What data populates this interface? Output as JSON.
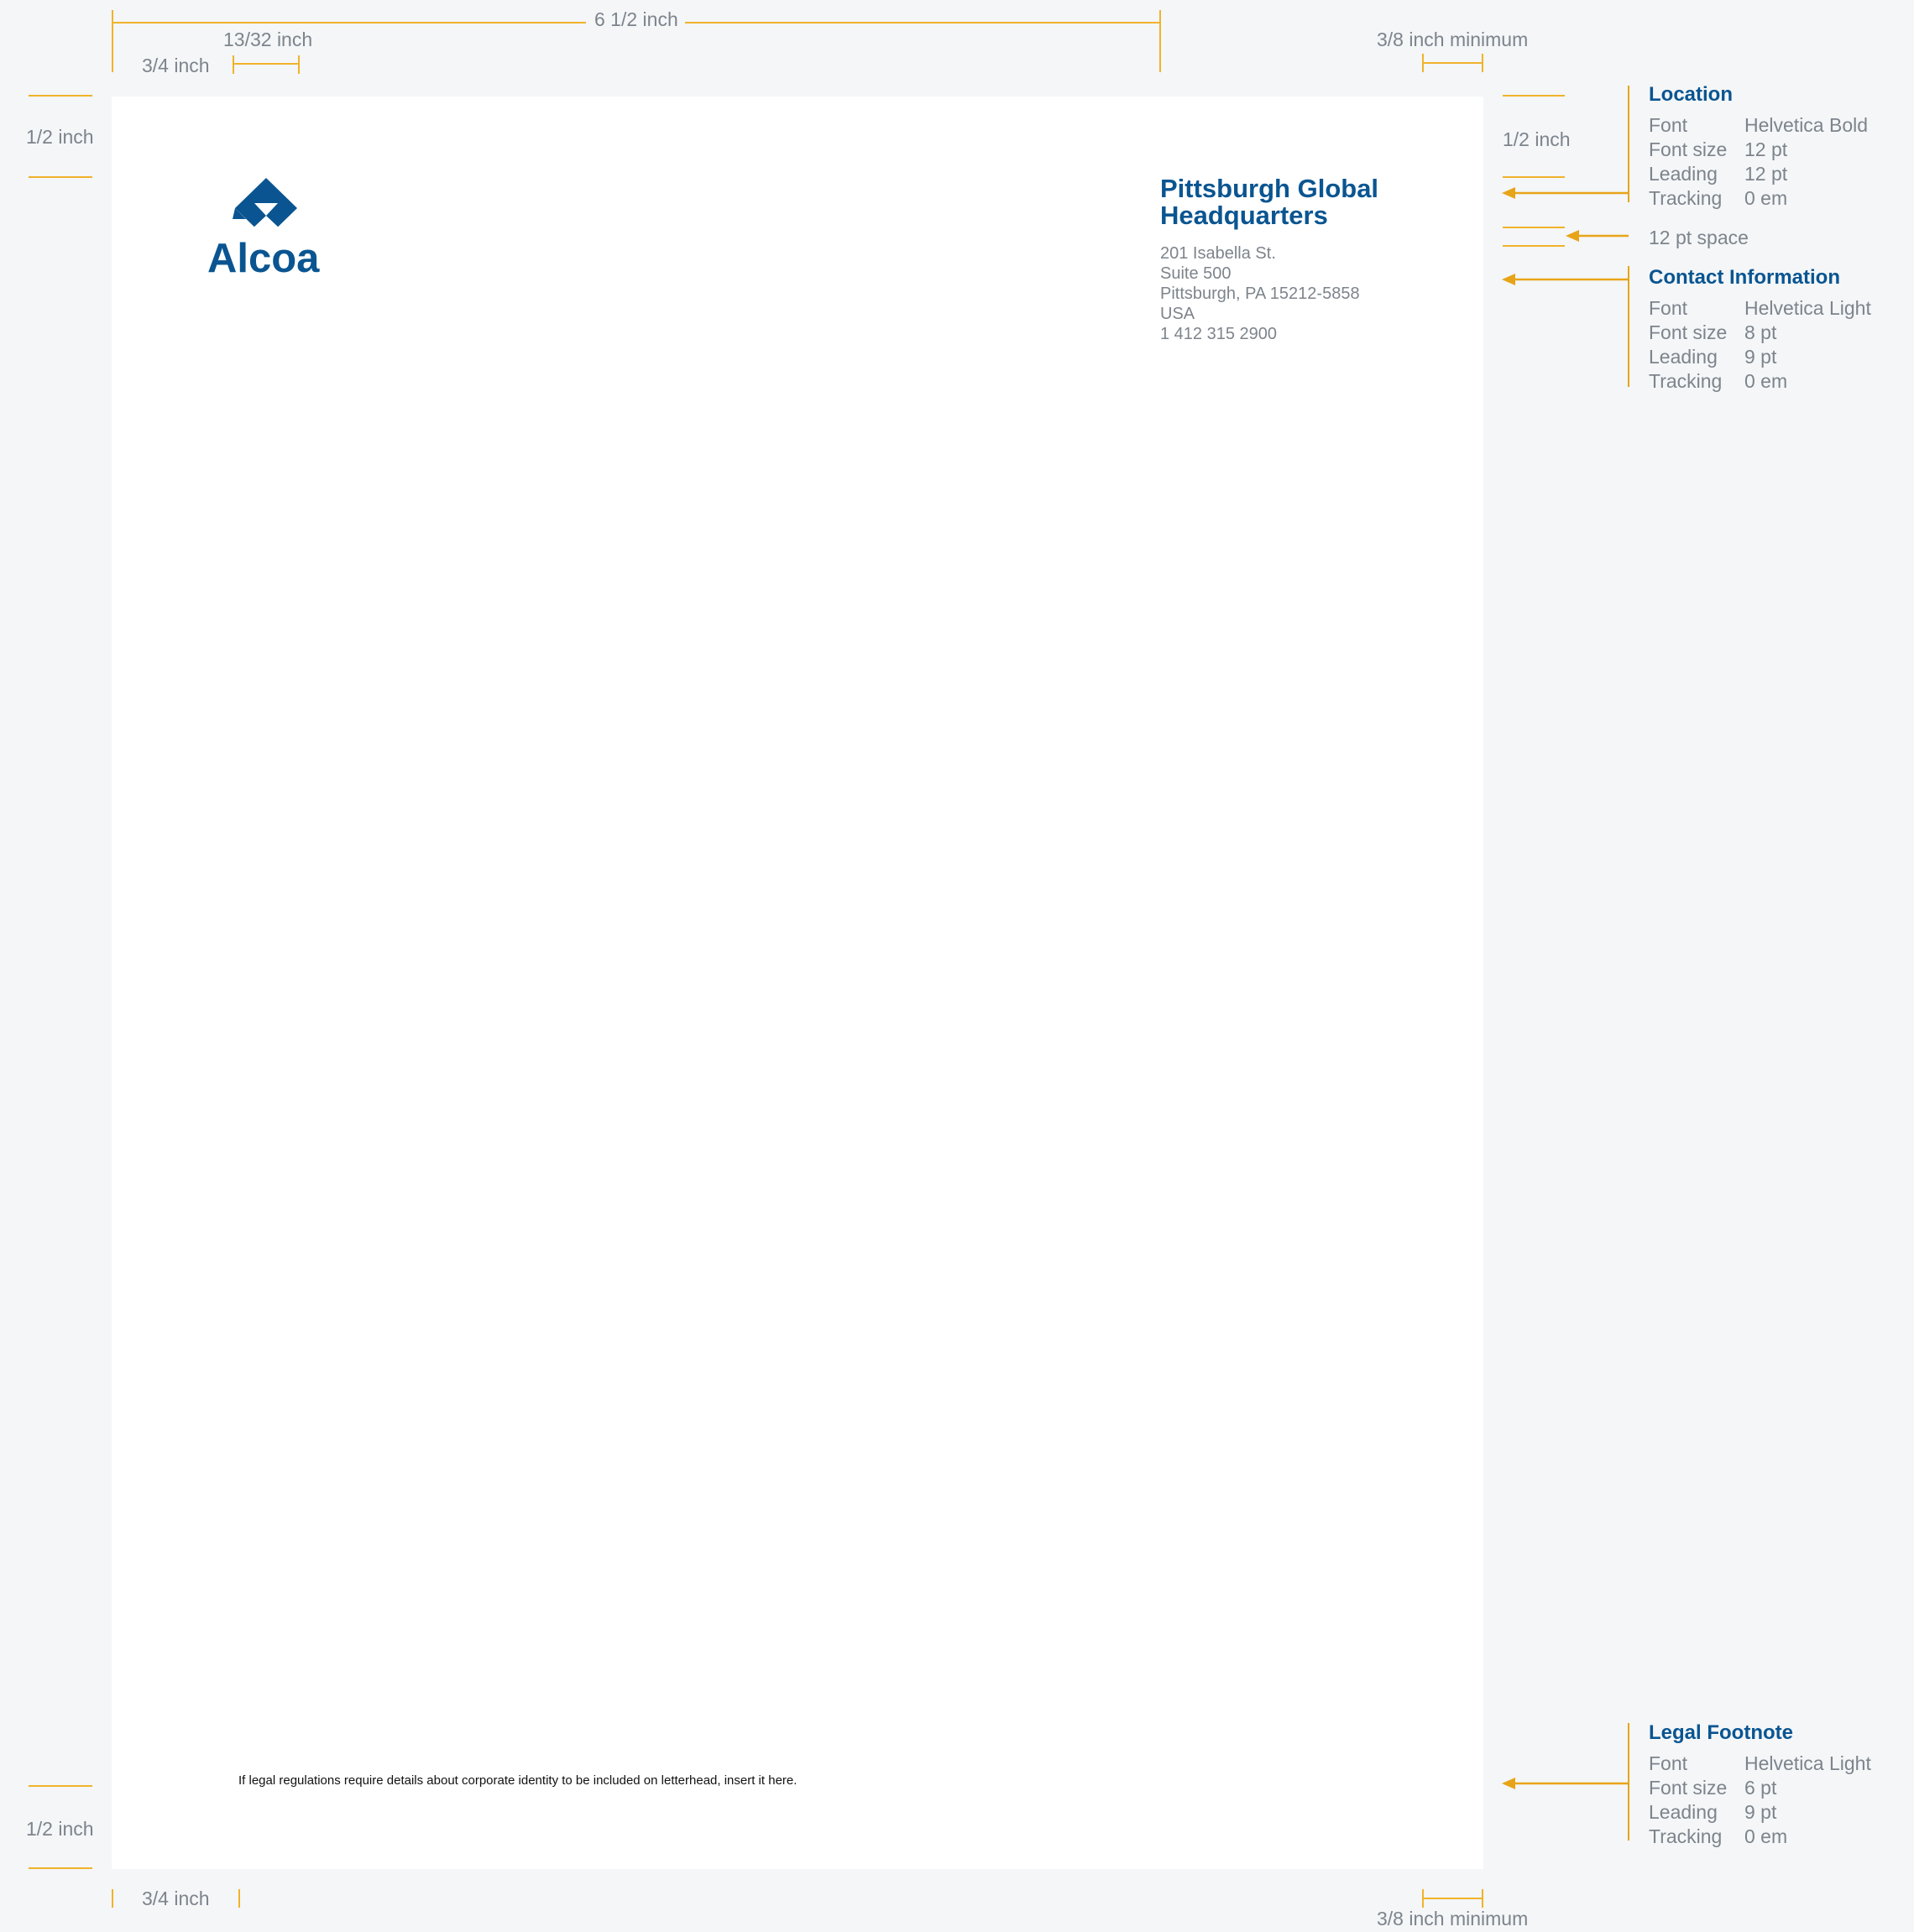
{
  "logo": {
    "wordmark": "Alcoa",
    "brand_color": "#0a5591"
  },
  "letterhead": {
    "location_title_line1": "Pittsburgh Global",
    "location_title_line2": "Headquarters",
    "address": [
      "201 Isabella St.",
      "Suite 500",
      "Pittsburgh, PA 15212-5858",
      "USA",
      "1 412 315 2900"
    ],
    "footnote": "If legal regulations require details about corporate identity to be included on letterhead, insert it here."
  },
  "dimensions": {
    "width_total": "6 1/2 inch",
    "logo_offset": "13/32 inch",
    "left_margin_top": "3/4 inch",
    "right_margin_top": "3/8 inch minimum",
    "top_margin_left": "1/2 inch",
    "top_margin_right": "1/2 inch",
    "bottom_margin_left": "1/2 inch",
    "left_margin_bottom": "3/4 inch",
    "right_margin_bottom": "3/8 inch minimum",
    "space_between": "12 pt space"
  },
  "specs": {
    "location": {
      "title": "Location",
      "rows": [
        {
          "label": "Font",
          "value": "Helvetica Bold"
        },
        {
          "label": "Font size",
          "value": "12 pt"
        },
        {
          "label": "Leading",
          "value": "12 pt"
        },
        {
          "label": "Tracking",
          "value": "0 em"
        }
      ]
    },
    "contact": {
      "title": "Contact Information",
      "rows": [
        {
          "label": "Font",
          "value": "Helvetica Light"
        },
        {
          "label": "Font size",
          "value": "8 pt"
        },
        {
          "label": "Leading",
          "value": "9 pt"
        },
        {
          "label": "Tracking",
          "value": "0 em"
        }
      ]
    },
    "footnote": {
      "title": "Legal Footnote",
      "rows": [
        {
          "label": "Font",
          "value": "Helvetica Light"
        },
        {
          "label": "Font size",
          "value": "6 pt"
        },
        {
          "label": "Leading",
          "value": "9 pt"
        },
        {
          "label": "Tracking",
          "value": "0 em"
        }
      ]
    }
  },
  "colors": {
    "guide": "#f0b32a",
    "arrow": "#e8a417",
    "label_gray": "#7d848c",
    "page": "#ffffff",
    "background": "#f4f6f8"
  }
}
